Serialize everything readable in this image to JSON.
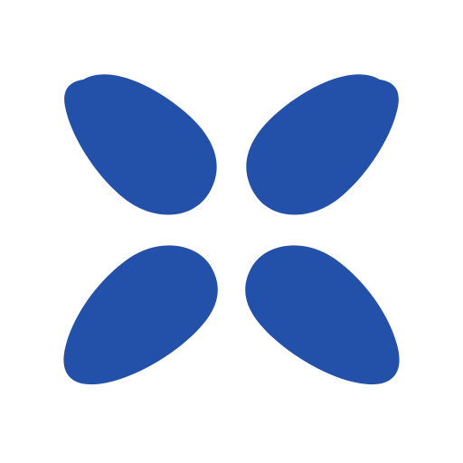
{
  "logo": {
    "icon": "four-petal-logo-icon",
    "color": "#2350A8",
    "background": "#ffffff",
    "petals": [
      {
        "name": "top-left"
      },
      {
        "name": "top-right"
      },
      {
        "name": "bottom-left"
      },
      {
        "name": "bottom-right"
      }
    ]
  }
}
